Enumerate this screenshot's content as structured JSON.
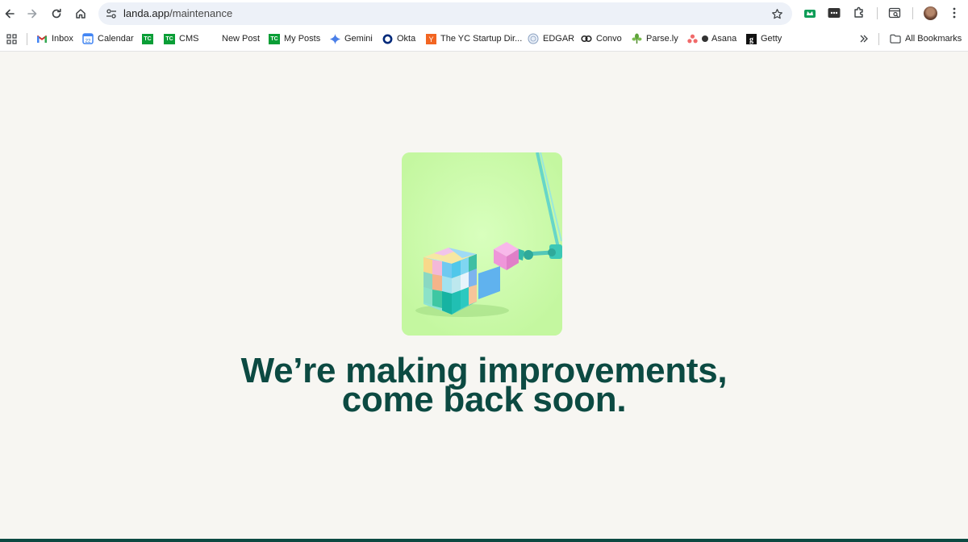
{
  "browser": {
    "url_host": "landa.app",
    "url_path": "/maintenance"
  },
  "bookmarks": {
    "items": [
      {
        "label": "Inbox",
        "icon": "gmail-icon"
      },
      {
        "label": "Calendar",
        "icon": "calendar-icon"
      },
      {
        "label": "",
        "icon": "tc-icon"
      },
      {
        "label": "CMS",
        "icon": "tc-icon"
      },
      {
        "label": "New Post",
        "icon": "none"
      },
      {
        "label": "My Posts",
        "icon": "tc-icon"
      },
      {
        "label": "Gemini",
        "icon": "gemini-icon"
      },
      {
        "label": "Okta",
        "icon": "okta-icon"
      },
      {
        "label": "The YC Startup Dir...",
        "icon": "yc-icon"
      },
      {
        "label": "EDGAR",
        "icon": "sec-seal-icon"
      },
      {
        "label": "Convo",
        "icon": "convo-icon"
      },
      {
        "label": "Parse.ly",
        "icon": "parsely-icon"
      },
      {
        "label": "Asana",
        "icon": "asana-icon"
      },
      {
        "label": "Getty",
        "icon": "getty-icon"
      }
    ],
    "all_bookmarks": "All Bookmarks"
  },
  "main": {
    "headline_line1": "We’re making improvements,",
    "headline_line2": "come back soon."
  },
  "colors": {
    "page_bg": "#f7f6f2",
    "headline": "#0c4a42",
    "hero_bg": "#c9fba6"
  }
}
